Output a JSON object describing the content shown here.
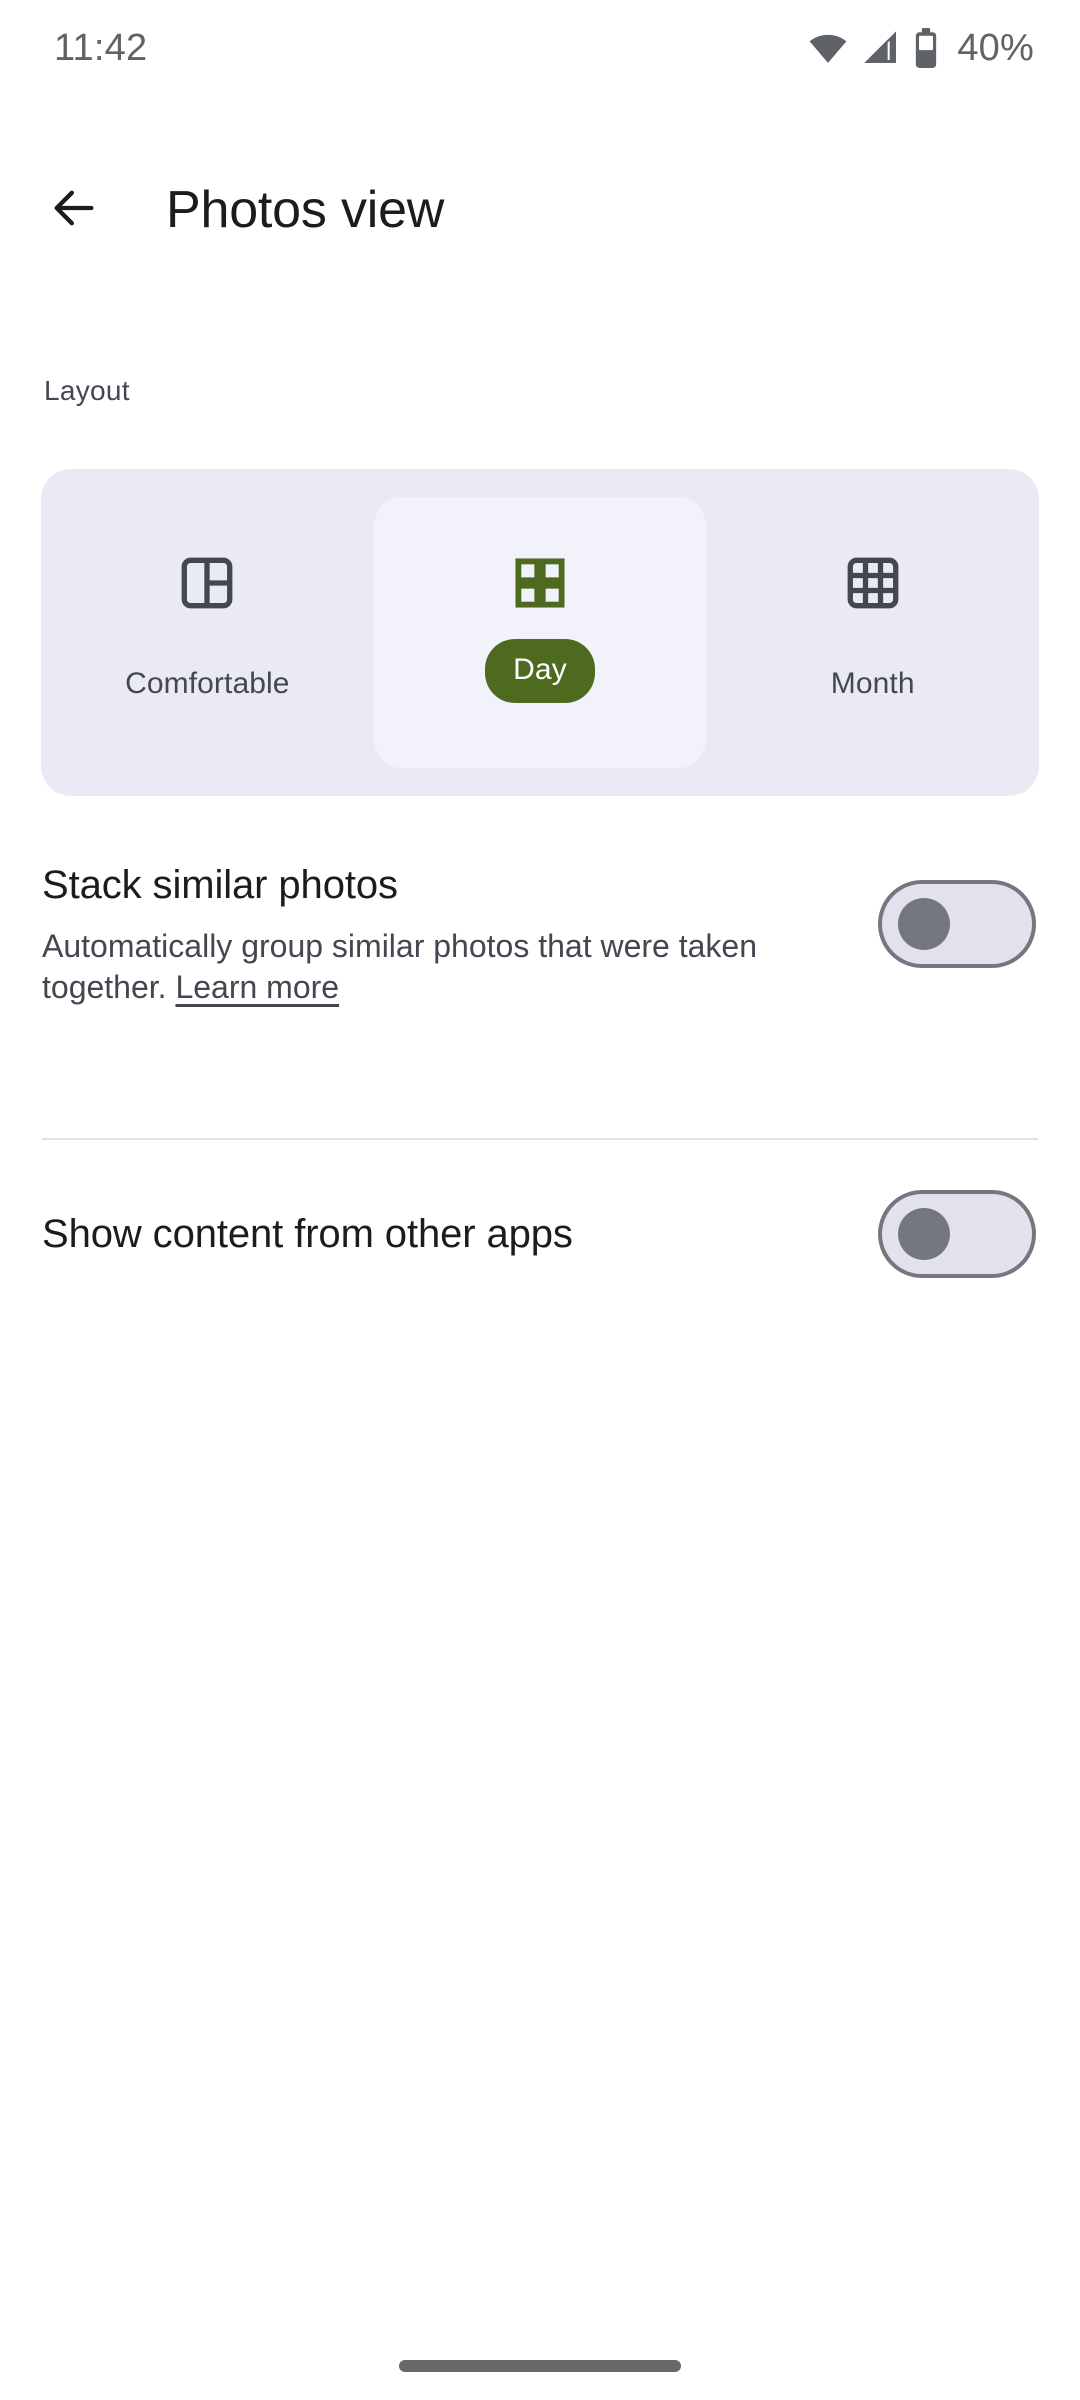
{
  "status_bar": {
    "time": "11:42",
    "battery_percent": "40%",
    "icons": [
      "wifi-icon",
      "cellular-signal-icon",
      "battery-icon"
    ]
  },
  "app_bar": {
    "back_icon": "back-arrow-icon",
    "title": "Photos view"
  },
  "layout_section": {
    "label": "Layout",
    "options": [
      {
        "label": "Comfortable",
        "icon": "comfortable-layout-icon",
        "selected": false
      },
      {
        "label": "Day",
        "icon": "day-grid-icon",
        "selected": true
      },
      {
        "label": "Month",
        "icon": "month-grid-icon",
        "selected": false
      }
    ]
  },
  "settings": [
    {
      "title": "Stack similar photos",
      "description": "Automatically group similar photos that were taken together. ",
      "link_text": "Learn more",
      "toggle_state": "off"
    },
    {
      "title": "Show content from other apps",
      "toggle_state": "off"
    }
  ],
  "colors": {
    "accent_green": "#4d6a1f",
    "segment_track": "#eaeaf4",
    "segment_selected": "#f2f2fa",
    "switch_track": "#e3e2ec",
    "switch_outline": "#73777f",
    "text_primary": "#1b1c1e",
    "text_secondary": "#444750",
    "divider": "#e2e2e4"
  }
}
